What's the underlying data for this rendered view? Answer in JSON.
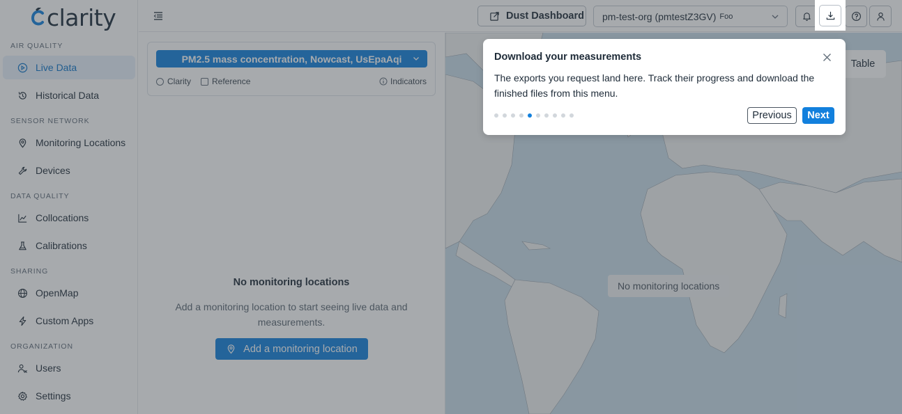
{
  "app": {
    "logo_text": "clarity"
  },
  "sidebar": {
    "sections": [
      {
        "label": "AIR QUALITY",
        "items": [
          {
            "label": "Live Data",
            "icon": "play-circle-icon",
            "active": true
          },
          {
            "label": "Historical Data",
            "icon": "history-icon"
          }
        ]
      },
      {
        "label": "SENSOR NETWORK",
        "items": [
          {
            "label": "Monitoring Locations",
            "icon": "location-pin-icon"
          },
          {
            "label": "Devices",
            "icon": "wrench-icon"
          }
        ]
      },
      {
        "label": "DATA QUALITY",
        "items": [
          {
            "label": "Collocations",
            "icon": "line-chart-icon"
          },
          {
            "label": "Calibrations",
            "icon": "flask-icon"
          }
        ]
      },
      {
        "label": "SHARING",
        "items": [
          {
            "label": "OpenMap",
            "icon": "globe-icon"
          },
          {
            "label": "Custom Apps",
            "icon": "lightning-icon"
          }
        ]
      },
      {
        "label": "ORGANIZATION",
        "items": [
          {
            "label": "Users",
            "icon": "users-icon"
          },
          {
            "label": "Settings",
            "icon": "gear-icon"
          }
        ]
      }
    ]
  },
  "topbar": {
    "dust_dashboard_label": "Dust Dashboard",
    "org_name": "pm-test-org (pmtestZ3GV)",
    "org_suffix": "Foo"
  },
  "filters": {
    "metric": "PM2.5 mass concentration, Nowcast, UsEpaAqi",
    "option_clarity": "Clarity",
    "option_reference": "Reference",
    "indicators": "Indicators"
  },
  "empty_state": {
    "title": "No monitoring locations",
    "subtitle": "Add a monitoring location to start seeing live data and measurements.",
    "button": "Add a monitoring location"
  },
  "map": {
    "empty_label": "No monitoring locations",
    "table_button": "Table"
  },
  "tour": {
    "title": "Download your measurements",
    "body": "The exports you request land here. Track their progress and download the finished files from this menu.",
    "step_count": 10,
    "current_step": 5,
    "prev_label": "Previous",
    "next_label": "Next"
  },
  "colors": {
    "accent": "#1280dd",
    "active_nav_bg": "#e7f1fb",
    "map_water": "#c9dcea"
  }
}
